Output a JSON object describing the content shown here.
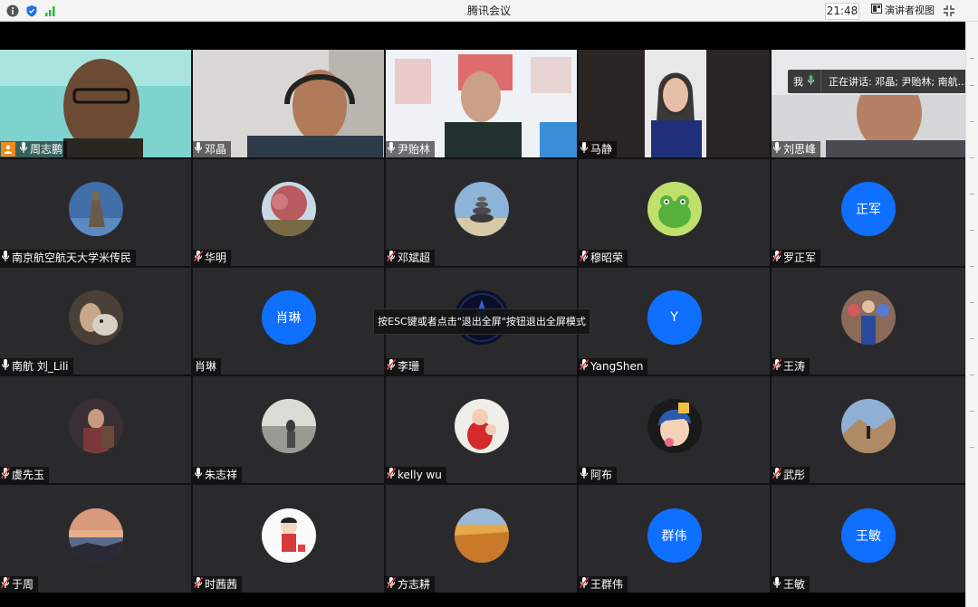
{
  "titlebar": {
    "title": "腾讯会议",
    "time": "21:48",
    "presenter_view_label": "演讲者视图",
    "icons": [
      "info-icon",
      "shield-icon",
      "signal-icon",
      "presenter-view-icon",
      "exit-fullscreen-icon"
    ]
  },
  "speaking": {
    "me_label": "我",
    "text": "正在讲话: 邓晶; 尹贻林; 南航..."
  },
  "toast": {
    "text": "按ESC键或者点击\"退出全屏\"按钮退出全屏模式"
  },
  "participants": [
    {
      "name": "周志鹏",
      "mic": "on",
      "kind": "video",
      "host": true
    },
    {
      "name": "邓晶",
      "mic": "on",
      "kind": "video"
    },
    {
      "name": "尹贻林",
      "mic": "on",
      "kind": "video"
    },
    {
      "name": "马静",
      "mic": "on",
      "kind": "video"
    },
    {
      "name": "刘思峰",
      "mic": "on",
      "kind": "video"
    },
    {
      "name": "南京航空航天大学米传民",
      "mic": "on",
      "kind": "photo"
    },
    {
      "name": "华明",
      "mic": "muted",
      "kind": "photo"
    },
    {
      "name": "邓斌超",
      "mic": "muted",
      "kind": "photo"
    },
    {
      "name": "穆昭荣",
      "mic": "muted",
      "kind": "photo"
    },
    {
      "name": "罗正军",
      "mic": "muted",
      "kind": "initials",
      "initials": "正军"
    },
    {
      "name": "南航 刘_Lili",
      "mic": "on",
      "kind": "photo"
    },
    {
      "name": "肖琳",
      "mic": "none",
      "kind": "initials",
      "initials": "肖琳"
    },
    {
      "name": "李珊",
      "mic": "muted",
      "kind": "photo"
    },
    {
      "name": "YangShen",
      "mic": "muted",
      "kind": "initials",
      "initials": "Y"
    },
    {
      "name": "王涛",
      "mic": "muted",
      "kind": "photo"
    },
    {
      "name": "虞先玉",
      "mic": "muted",
      "kind": "photo"
    },
    {
      "name": "朱志祥",
      "mic": "on",
      "kind": "photo"
    },
    {
      "name": "kelly wu",
      "mic": "muted",
      "kind": "photo"
    },
    {
      "name": "阿布",
      "mic": "on",
      "kind": "photo"
    },
    {
      "name": "武彤",
      "mic": "muted",
      "kind": "photo"
    },
    {
      "name": "于周",
      "mic": "muted",
      "kind": "photo"
    },
    {
      "name": "时茜茜",
      "mic": "muted",
      "kind": "photo"
    },
    {
      "name": "方志耕",
      "mic": "muted",
      "kind": "photo"
    },
    {
      "name": "王群伟",
      "mic": "muted",
      "kind": "initials",
      "initials": "群伟"
    },
    {
      "name": "王敏",
      "mic": "on",
      "kind": "initials",
      "initials": "王敏"
    }
  ]
}
